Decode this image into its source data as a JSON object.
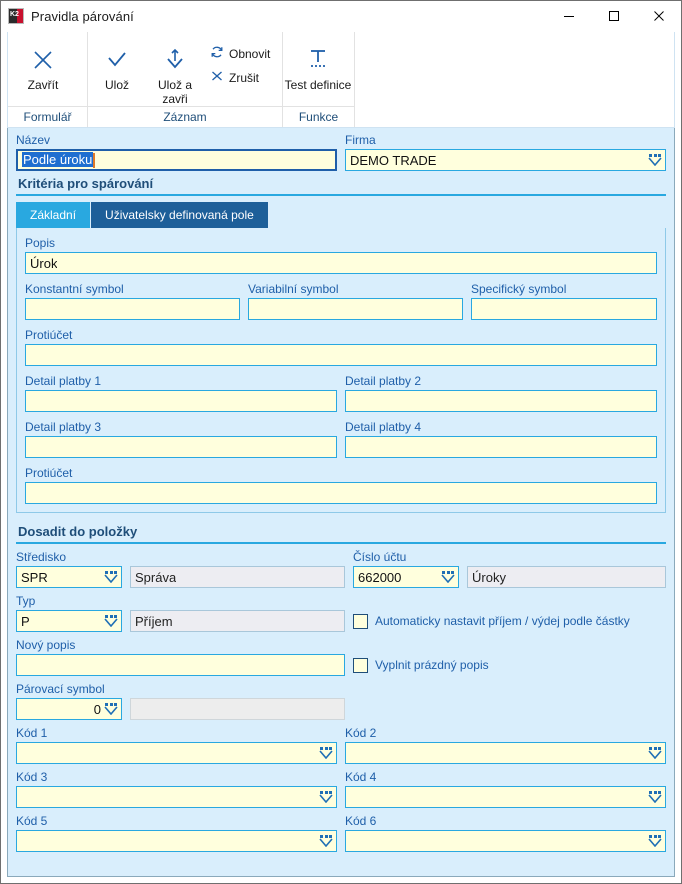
{
  "window": {
    "title": "Pravidla párování",
    "app_icon": "k2-logo-icon",
    "controls": {
      "minimize": "minimize-icon",
      "maximize": "maximize-icon",
      "close": "close-icon"
    }
  },
  "ribbon": {
    "groups": [
      {
        "title": "Formulář",
        "buttons": [
          {
            "label": "Zavřít",
            "icon": "close-x-icon",
            "size": "big"
          }
        ]
      },
      {
        "title": "Záznam",
        "buttons": [
          {
            "label": "Ulož",
            "icon": "check-icon",
            "size": "big"
          },
          {
            "label": "Ulož a zavři",
            "icon": "save-and-close-arrow-icon",
            "size": "big"
          },
          {
            "label": "Obnovit",
            "icon": "refresh-icon",
            "size": "small"
          },
          {
            "label": "Zrušit",
            "icon": "cancel-x-icon",
            "size": "small"
          }
        ]
      },
      {
        "title": "Funkce",
        "buttons": [
          {
            "label": "Test definice",
            "icon": "text-definition-icon",
            "size": "big"
          }
        ]
      }
    ]
  },
  "header_fields": {
    "nazev": {
      "label": "Název",
      "value": "Podle úroku",
      "selected": true
    },
    "firma": {
      "label": "Firma",
      "value": "DEMO TRADE",
      "dropdown": true
    }
  },
  "criteria_section": {
    "title": "Kritéria pro spárování",
    "tabs": [
      {
        "label": "Základní",
        "active": true
      },
      {
        "label": "Uživatelsky definovaná pole",
        "active": false
      }
    ],
    "fields": {
      "popis": {
        "label": "Popis",
        "value": "Úrok"
      },
      "konstantni_symbol": {
        "label": "Konstantní symbol",
        "value": ""
      },
      "variabilni_symbol": {
        "label": "Variabilní symbol",
        "value": ""
      },
      "specificky_symbol": {
        "label": "Specifický symbol",
        "value": ""
      },
      "protiucet_1": {
        "label": "Protiúčet",
        "value": ""
      },
      "detail_platby_1": {
        "label": "Detail platby 1",
        "value": ""
      },
      "detail_platby_2": {
        "label": "Detail platby 2",
        "value": ""
      },
      "detail_platby_3": {
        "label": "Detail platby 3",
        "value": ""
      },
      "detail_platby_4": {
        "label": "Detail platby 4",
        "value": ""
      },
      "protiucet_2": {
        "label": "Protiúčet",
        "value": ""
      }
    }
  },
  "insert_section": {
    "title": "Dosadit do položky",
    "stredisko": {
      "label": "Středisko",
      "code": "SPR",
      "name": "Správa"
    },
    "cislo_uctu": {
      "label": "Číslo účtu",
      "code": "662000",
      "name": "Úroky"
    },
    "typ": {
      "label": "Typ",
      "code": "P",
      "name": "Příjem"
    },
    "auto_set_checkbox": {
      "label": "Automaticky nastavit příjem / výdej podle částky",
      "checked": false
    },
    "novy_popis": {
      "label": "Nový popis",
      "value": ""
    },
    "fill_empty_checkbox": {
      "label": "Vyplnit prázdný popis",
      "checked": false
    },
    "parovaci_symbol": {
      "label": "Párovací symbol",
      "value": "0",
      "secondary_value": ""
    },
    "codes": [
      {
        "label": "Kód 1",
        "value": ""
      },
      {
        "label": "Kód 2",
        "value": ""
      },
      {
        "label": "Kód 3",
        "value": ""
      },
      {
        "label": "Kód 4",
        "value": ""
      },
      {
        "label": "Kód 5",
        "value": ""
      },
      {
        "label": "Kód 6",
        "value": ""
      }
    ]
  },
  "colors": {
    "accent_cyan": "#29a8e0",
    "accent_navy": "#1d5f99",
    "label_blue": "#1f5fa9",
    "field_yellow": "#ffffdd",
    "form_bg": "#d9eefc",
    "selection_blue": "#1f6fd0"
  }
}
